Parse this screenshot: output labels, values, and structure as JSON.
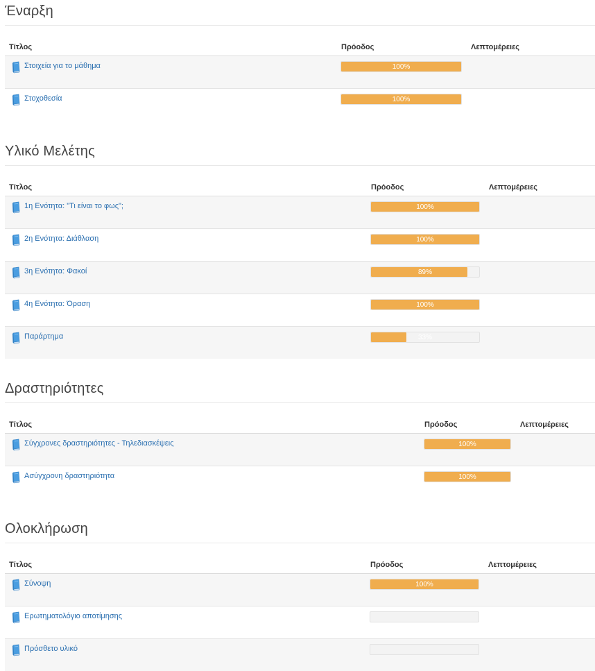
{
  "headers": {
    "title": "Τίτλος",
    "progress": "Πρόοδος",
    "details": "Λεπτομέρειες"
  },
  "accent_color": "#f0ad4e",
  "link_color": "#2a6fb0",
  "sections": [
    {
      "title": "Έναρξη",
      "items": [
        {
          "label": "Στοιχεία για το μάθημα",
          "progress": 100,
          "progress_text": "100%"
        },
        {
          "label": "Στοχοθεσία",
          "progress": 100,
          "progress_text": "100%"
        }
      ]
    },
    {
      "title": "Υλικό Μελέτης",
      "items": [
        {
          "label": "1η Ενότητα: \"Τι είναι το φως\";",
          "progress": 100,
          "progress_text": "100%"
        },
        {
          "label": "2η Ενότητα: Διάθλαση",
          "progress": 100,
          "progress_text": "100%"
        },
        {
          "label": "3η Ενότητα: Φακοί",
          "progress": 89,
          "progress_text": "89%"
        },
        {
          "label": "4η Ενότητα: Όραση",
          "progress": 100,
          "progress_text": "100%"
        },
        {
          "label": "Παράρτημα",
          "progress": 33,
          "progress_text": "33%"
        }
      ]
    },
    {
      "title": "Δραστηριότητες",
      "items": [
        {
          "label": "Σύγχρονες δραστηριότητες - Τηλεδιασκέψεις",
          "progress": 100,
          "progress_text": "100%"
        },
        {
          "label": "Ασύγχρονη δραστηριότητα",
          "progress": 100,
          "progress_text": "100%"
        }
      ]
    },
    {
      "title": "Ολοκλήρωση",
      "items": [
        {
          "label": "Σύνοψη",
          "progress": 100,
          "progress_text": "100%"
        },
        {
          "label": "Ερωτηματολόγιο αποτίμησης",
          "progress": 0,
          "progress_text": ""
        },
        {
          "label": "Πρόσθετο υλικό",
          "progress": 0,
          "progress_text": ""
        }
      ]
    }
  ]
}
